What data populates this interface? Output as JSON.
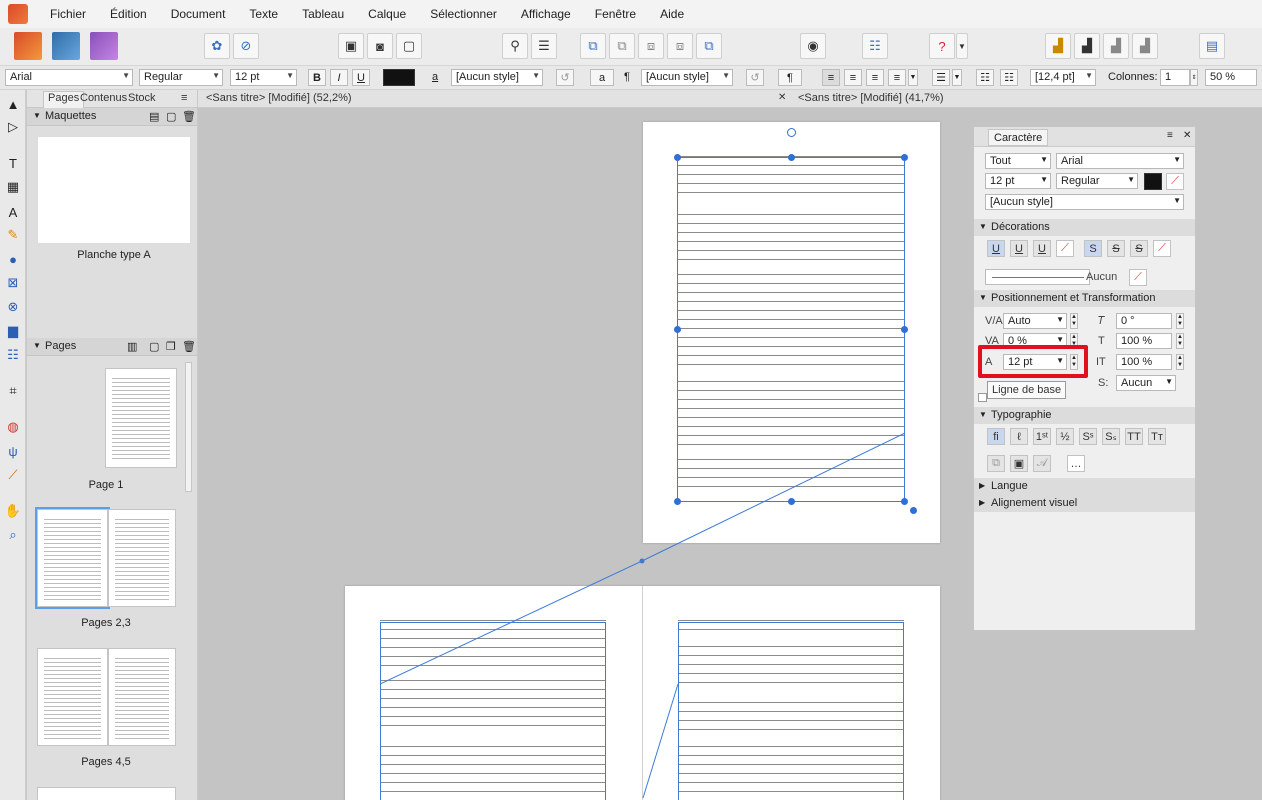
{
  "menubar": {
    "items": [
      "Fichier",
      "Édition",
      "Document",
      "Texte",
      "Tableau",
      "Calque",
      "Sélectionner",
      "Affichage",
      "Fenêtre",
      "Aide"
    ]
  },
  "context": {
    "font": "Arial",
    "style": "Regular",
    "size": "12 pt",
    "bold": "B",
    "italic": "I",
    "underline": "U",
    "char_style_icon": "a",
    "char_style": "[Aucun style]",
    "para_icon": "¶",
    "para_style": "[Aucun style]",
    "leading": "[12,4 pt]",
    "columns_label": "Colonnes:",
    "columns_value": "1",
    "zoom": "50 %"
  },
  "left_panel": {
    "tabs": [
      "Pages",
      "Contenus",
      "Stock"
    ],
    "masters_title": "Maquettes",
    "master_label": "Planche type A",
    "pages_title": "Pages",
    "page_labels": [
      "Page 1",
      "Pages 2,3",
      "Pages 4,5"
    ]
  },
  "doc_tabs": [
    "<Sans titre> [Modifié] (52,2%)",
    "<Sans titre> [Modifié] (41,7%)"
  ],
  "character_panel": {
    "tab": "Caractère",
    "scope": "Tout",
    "font": "Arial",
    "size": "12 pt",
    "style": "Regular",
    "char_style": "[Aucun style]",
    "decorations_title": "Décorations",
    "decoration_none": "Aucun",
    "position_title": "Positionnement et Transformation",
    "kerning": "Auto",
    "tracking": "0 %",
    "baseline": "12 pt",
    "shear": "0 °",
    "scale_v": "100 %",
    "scale_h": "100 %",
    "script": "Aucun",
    "tooltip": "Ligne de base",
    "typography_title": "Typographie",
    "language_title": "Langue",
    "visual_alignment_title": "Alignement visuel"
  },
  "colors": {
    "accent": "#2f6fd6",
    "highlight": "#e1101d"
  }
}
